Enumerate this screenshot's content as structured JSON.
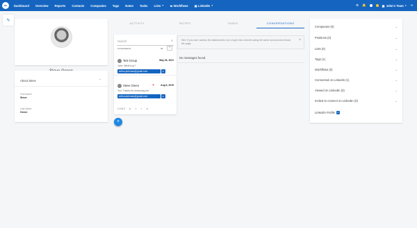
{
  "topbar": {
    "logo": "NG",
    "nav": [
      {
        "label": "Dashboard"
      },
      {
        "label": "Overview"
      },
      {
        "label": "Reports"
      },
      {
        "label": "Contacts"
      },
      {
        "label": "Companies"
      },
      {
        "label": "Tags"
      },
      {
        "label": "Notes"
      },
      {
        "label": "Tasks"
      },
      {
        "label": "Lists"
      },
      {
        "label": "Workflows"
      },
      {
        "label": "LinkedIn"
      }
    ],
    "team": "John's Team"
  },
  "profile": {
    "name": "Steve Green"
  },
  "about": {
    "title": "About Steve",
    "first_name_label": "First Name",
    "first_name": "Steve",
    "last_name_label": "Last Name",
    "last_name": "Green"
  },
  "tabs": [
    "ACTIVITY",
    "NOTES",
    "TASKS",
    "CONVERSATIONS"
  ],
  "conversations": {
    "search_placeholder": "Search",
    "header": "Conversations",
    "filter_value": "All",
    "items": [
      {
        "name": "Test Group",
        "date": "May 26, 2021",
        "message": "John: What's up?",
        "email": "arthur.pinkman@gmail.com"
      },
      {
        "name": "Steve Green",
        "date": "Aug 6, 2019",
        "message": "You: Thanks for endorsing me",
        "email": "arthur.pinkman@gmail.com"
      }
    ],
    "pager": [
      "1-2 of 2",
      "|<",
      "<",
      ">",
      ">|"
    ]
  },
  "hint": {
    "text": "Hint: If you can't access the attachments, try to login into LinkedIn using the same account and reload the page.",
    "close": "close"
  },
  "messages": {
    "empty": "No messages found."
  },
  "side": [
    {
      "label": "Companies (0)"
    },
    {
      "label": "Positions (0)"
    },
    {
      "label": "Lists (0)"
    },
    {
      "label": "Tags (1)"
    },
    {
      "label": "Workflows (0)"
    },
    {
      "label": "Connected on LinkedIn (1)"
    },
    {
      "label": "Viewed on LinkedIn (0)"
    },
    {
      "label": "Invited to connect on LinkedIn (0)"
    },
    {
      "label": "LinkedIn Profile"
    }
  ],
  "colors": {
    "primary": "#1565c0",
    "accent": "#1e88e5",
    "flag": "#e53935"
  }
}
